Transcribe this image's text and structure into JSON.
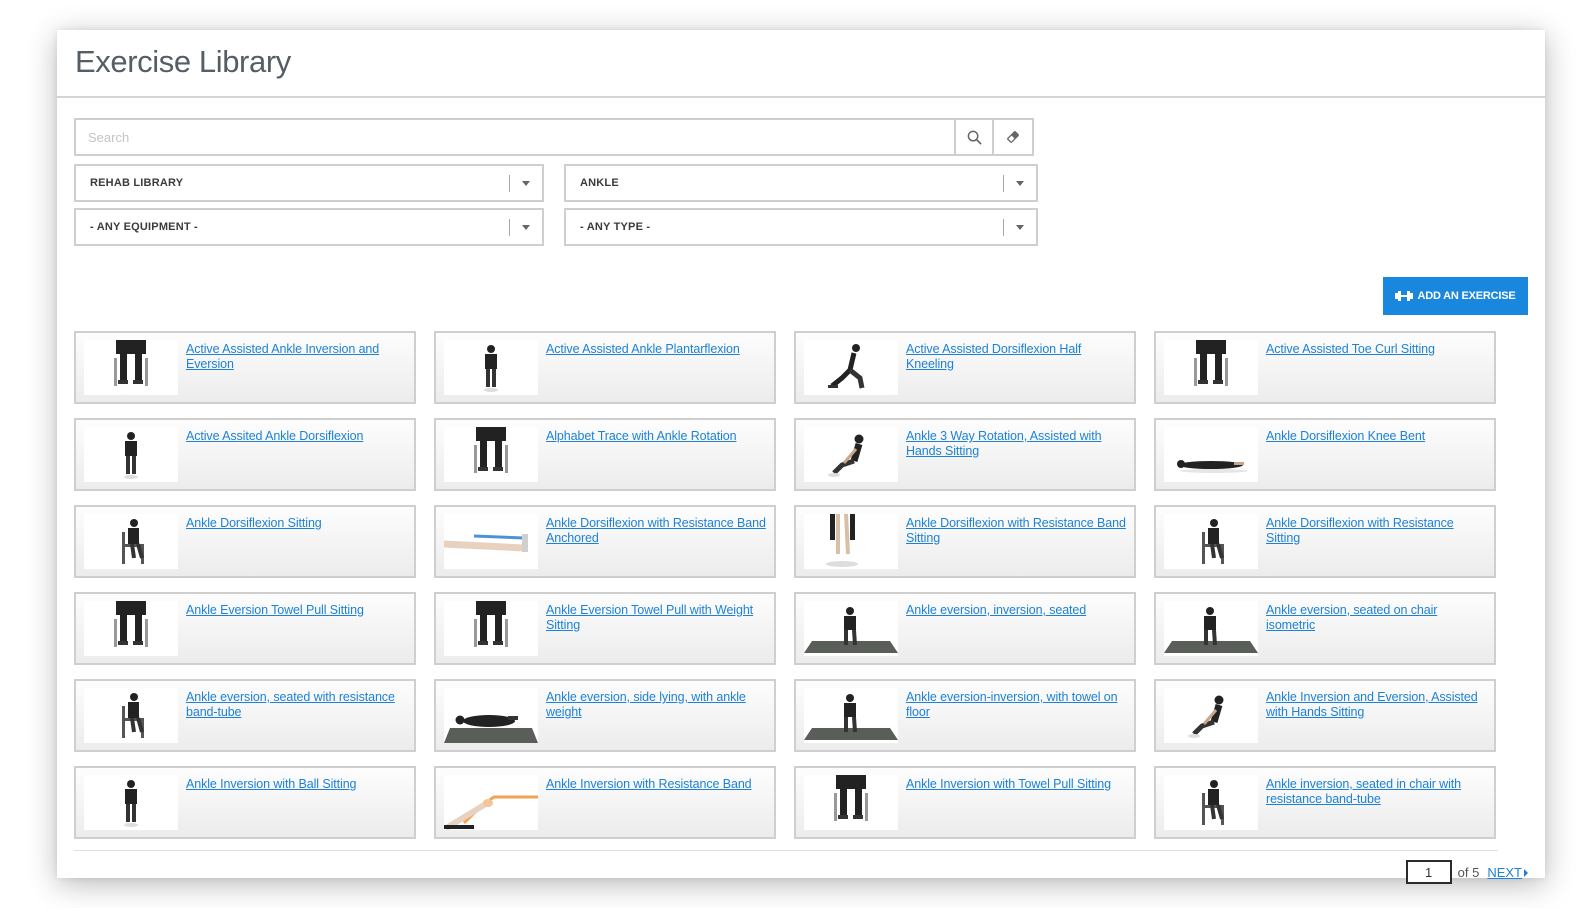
{
  "page": {
    "title": "Exercise Library"
  },
  "search": {
    "placeholder": "Search",
    "value": ""
  },
  "filters": {
    "library": "REHAB LIBRARY",
    "body_part": "ANKLE",
    "equipment": "- ANY EQUIPMENT -",
    "type": "- ANY TYPE -"
  },
  "actions": {
    "add_exercise": "ADD AN EXERCISE"
  },
  "exercises": [
    {
      "title": "Active Assisted Ankle Inversion and Eversion",
      "thumb": "seated-legs"
    },
    {
      "title": "Active Assisted Ankle Plantarflexion",
      "thumb": "standing-person"
    },
    {
      "title": "Active Assisted Dorsiflexion Half Kneeling",
      "thumb": "kneeling-person"
    },
    {
      "title": "Active Assisted Toe Curl Sitting",
      "thumb": "seated-legs"
    },
    {
      "title": "Active Assited Ankle Dorsiflexion",
      "thumb": "standing-person"
    },
    {
      "title": "Alphabet Trace with Ankle Rotation",
      "thumb": "seated-legs"
    },
    {
      "title": "Ankle 3 Way Rotation, Assisted with Hands Sitting",
      "thumb": "floor-sitting-person"
    },
    {
      "title": "Ankle Dorsiflexion Knee Bent",
      "thumb": "lying-person"
    },
    {
      "title": "Ankle Dorsiflexion Sitting",
      "thumb": "chair-person"
    },
    {
      "title": "Ankle Dorsiflexion with Resistance Band Anchored",
      "thumb": "band-legs"
    },
    {
      "title": "Ankle Dorsiflexion with Resistance Band Sitting",
      "thumb": "standing-legs"
    },
    {
      "title": "Ankle Dorsiflexion with Resistance Sitting",
      "thumb": "chair-person"
    },
    {
      "title": "Ankle Eversion Towel Pull Sitting",
      "thumb": "seated-legs"
    },
    {
      "title": "Ankle Eversion Towel Pull with Weight Sitting",
      "thumb": "seated-legs"
    },
    {
      "title": "Ankle eversion, inversion, seated",
      "thumb": "mat-person"
    },
    {
      "title": "Ankle eversion, seated on chair isometric",
      "thumb": "mat-person"
    },
    {
      "title": "Ankle eversion, seated with resistance band-tube",
      "thumb": "chair-person"
    },
    {
      "title": "Ankle eversion, side lying, with ankle weight",
      "thumb": "mat-lying-person"
    },
    {
      "title": "Ankle eversion-inversion, with towel on floor",
      "thumb": "mat-person"
    },
    {
      "title": "Ankle Inversion and Eversion, Assisted with Hands Sitting",
      "thumb": "floor-sitting-person"
    },
    {
      "title": "Ankle Inversion with Ball Sitting",
      "thumb": "standing-person"
    },
    {
      "title": "Ankle Inversion with Resistance Band",
      "thumb": "orange-band-leg"
    },
    {
      "title": "Ankle Inversion with Towel Pull Sitting",
      "thumb": "seated-legs"
    },
    {
      "title": "Ankle inversion, seated in chair with resistance band-tube",
      "thumb": "chair-person"
    }
  ],
  "pagination": {
    "current": "1",
    "of_label": "of 5",
    "next_label": "NEXT"
  },
  "colors": {
    "link": "#1d82d6",
    "primary_button": "#1a87df",
    "border": "#cfcfcf"
  },
  "icons": {
    "search": "search-icon",
    "clear": "eraser-icon",
    "add": "weight-icon"
  }
}
